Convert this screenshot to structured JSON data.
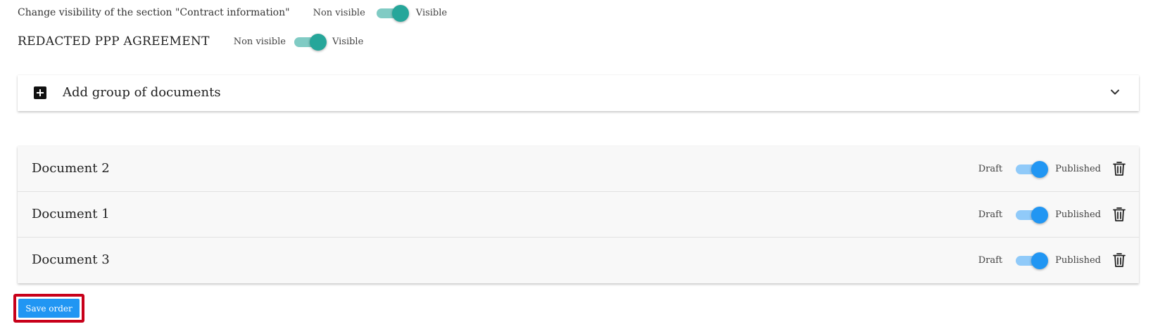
{
  "visibility": {
    "section_label": "Change visibility of the section \"Contract information\"",
    "off_label": "Non visible",
    "on_label": "Visible",
    "state": "Visible"
  },
  "ppp": {
    "title": "REDACTED PPP AGREEMENT",
    "off_label": "Non visible",
    "on_label": "Visible",
    "state": "Visible"
  },
  "add_group": {
    "label": "Add group of documents",
    "icons": {
      "add": "plus-square-icon",
      "expand": "chevron-down-icon"
    }
  },
  "documents": [
    {
      "name": "Document 2",
      "off_label": "Draft",
      "on_label": "Published",
      "state": "Published"
    },
    {
      "name": "Document 1",
      "off_label": "Draft",
      "on_label": "Published",
      "state": "Published"
    },
    {
      "name": "Document 3",
      "off_label": "Draft",
      "on_label": "Published",
      "state": "Published"
    }
  ],
  "actions": {
    "save_order": "Save order"
  },
  "colors": {
    "teal_toggle": "#26a69a",
    "blue_toggle": "#2196f3",
    "save_button": "#2196f3",
    "highlight_border": "#c8001a"
  }
}
